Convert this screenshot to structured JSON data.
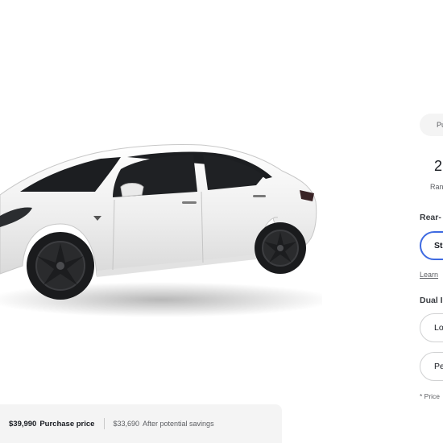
{
  "vehicle": {
    "paint_color": "#f2f2f2",
    "glass_color": "#1c1e21",
    "wheel_color": "#2a2b2d"
  },
  "price_bar": {
    "purchase_price": "$39,990",
    "purchase_label": "Purchase price",
    "savings_price": "$33,690",
    "savings_label": "After potential savings"
  },
  "config_panel": {
    "tab_label": "Pu",
    "spec_value": "2",
    "spec_label": "Ran",
    "group_rwd_title": "Rear-",
    "option_standard": "St",
    "learn_more": "Learn",
    "group_dual_title": "Dual I",
    "option_long_range": "Lo",
    "option_performance": "Pe",
    "footnote": "* Price"
  }
}
